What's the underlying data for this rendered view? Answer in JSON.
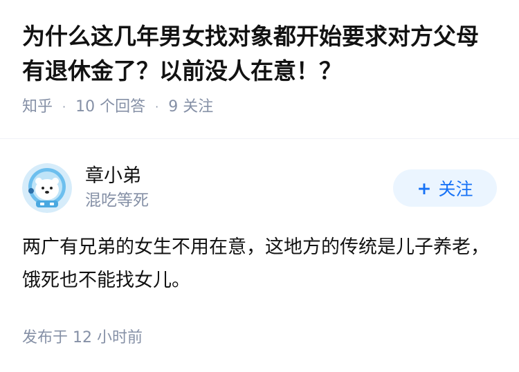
{
  "question": {
    "title": "为什么这几年男女找对象都开始要求对方父母有退休金了？以前没人在意！？",
    "source": "知乎",
    "answer_count": "10 个回答",
    "follower_count": "9 关注",
    "separator": "·"
  },
  "answer": {
    "author_name": "章小弟",
    "author_signature": "混吃等死",
    "follow_plus": "+",
    "follow_label": "关注",
    "content": "两广有兄弟的女生不用在意，这地方的传统是儿子养老，饿死也不能找女儿。",
    "published": "发布于 12 小时前"
  },
  "colors": {
    "accent": "#1772f6",
    "follow_bg": "#ebf5ff",
    "meta_gray": "#8590a6",
    "text": "#121212"
  },
  "icons": {
    "avatar": "polar-bear-astronaut-avatar"
  }
}
